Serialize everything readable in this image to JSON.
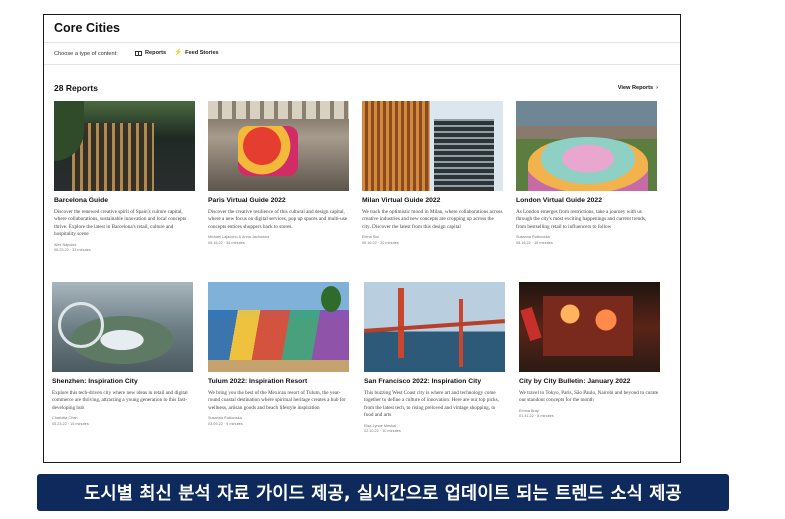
{
  "header": {
    "title": "Core Cities"
  },
  "content_type": {
    "label": "Choose a type of content:",
    "options": [
      {
        "label": "Reports",
        "icon": "grid-icon"
      },
      {
        "label": "Feed Stories",
        "icon": "bolt-icon"
      }
    ]
  },
  "reports": {
    "count_label": "28 Reports",
    "view_all_label": "View Reports",
    "cards": [
      {
        "title": "Barcelona Guide",
        "description": "Discover the renewed creative spirit of Spain's culture capital, where collaborations, sustainable innovation and local concepts thrive. Explore the latest in Barcelona's retail, culture and hospitality scene",
        "author": "Alex Nápoles",
        "date": "05.23.22 · 33 minutes"
      },
      {
        "title": "Paris Virtual Guide 2022",
        "description": "Discover the creative resilience of this cultural and design capital, where a new focus on digital services, pop up spaces and multi-use concepts entices shoppers back to stores.",
        "author": "Michael Lajacono & Anna Jachowicz",
        "date": "05.16.22 · 34 minutes"
      },
      {
        "title": "Milan Virtual Guide 2022",
        "description": "We track the optimistic mood in Milan, where collaborations across creative industries and new concepts are cropping up across the city. Discover the latest from this design capital",
        "author": "Elena Sisi",
        "date": "05.16.22 · 20 minutes"
      },
      {
        "title": "London Virtual Guide 2022",
        "description": "As London emerges from restrictions, take a journey with us through the city's most exciting happenings and current trends, from bestselling retail to influencers to follow",
        "author": "Susanna Rutkovska",
        "date": "05.16.22 · 16 minutes"
      },
      {
        "title": "Shenzhen: Inspiration City",
        "description": "Explore this tech-driven city where new ideas in retail and digital commerce are thriving, attracting a young generation to this fast-developing hub",
        "author": "Charlotte Chan",
        "date": "05.23.22 · 15 minutes"
      },
      {
        "title": "Tulum 2022: Inspiration Resort",
        "description": "We bring you the best of the Mexican resort of Tulum, the year-round coastal destination where spiritual heritage creates a hub for wellness, artisan goods and beach lifestyle inspiration",
        "author": "Susanna Rutkovska",
        "date": "03.09.22 · 9 minutes"
      },
      {
        "title": "San Francisco 2022: Inspiration City",
        "description": "This buzzing West Coast city is where art and technology come together to define a culture of innovation. Here are our top picks, from the latest tech, to rising preloved and vintage shopping, to food and arts",
        "author": "Elsa-Lynne Meskal",
        "date": "02.10.22 · 10 minutes"
      },
      {
        "title": "City by City Bulletin: January 2022",
        "description": "We travel to Tokyo, Paris, São Paulo, Nairobi and beyond to curate our standout concepts for the month",
        "author": "Emma Bray",
        "date": "01.31.22 · 6 minutes"
      }
    ]
  },
  "caption": {
    "text": "도시별 최신 분석 자료 가이드 제공, 실시간으로 업데이트 되는 트렌드 소식 제공"
  }
}
